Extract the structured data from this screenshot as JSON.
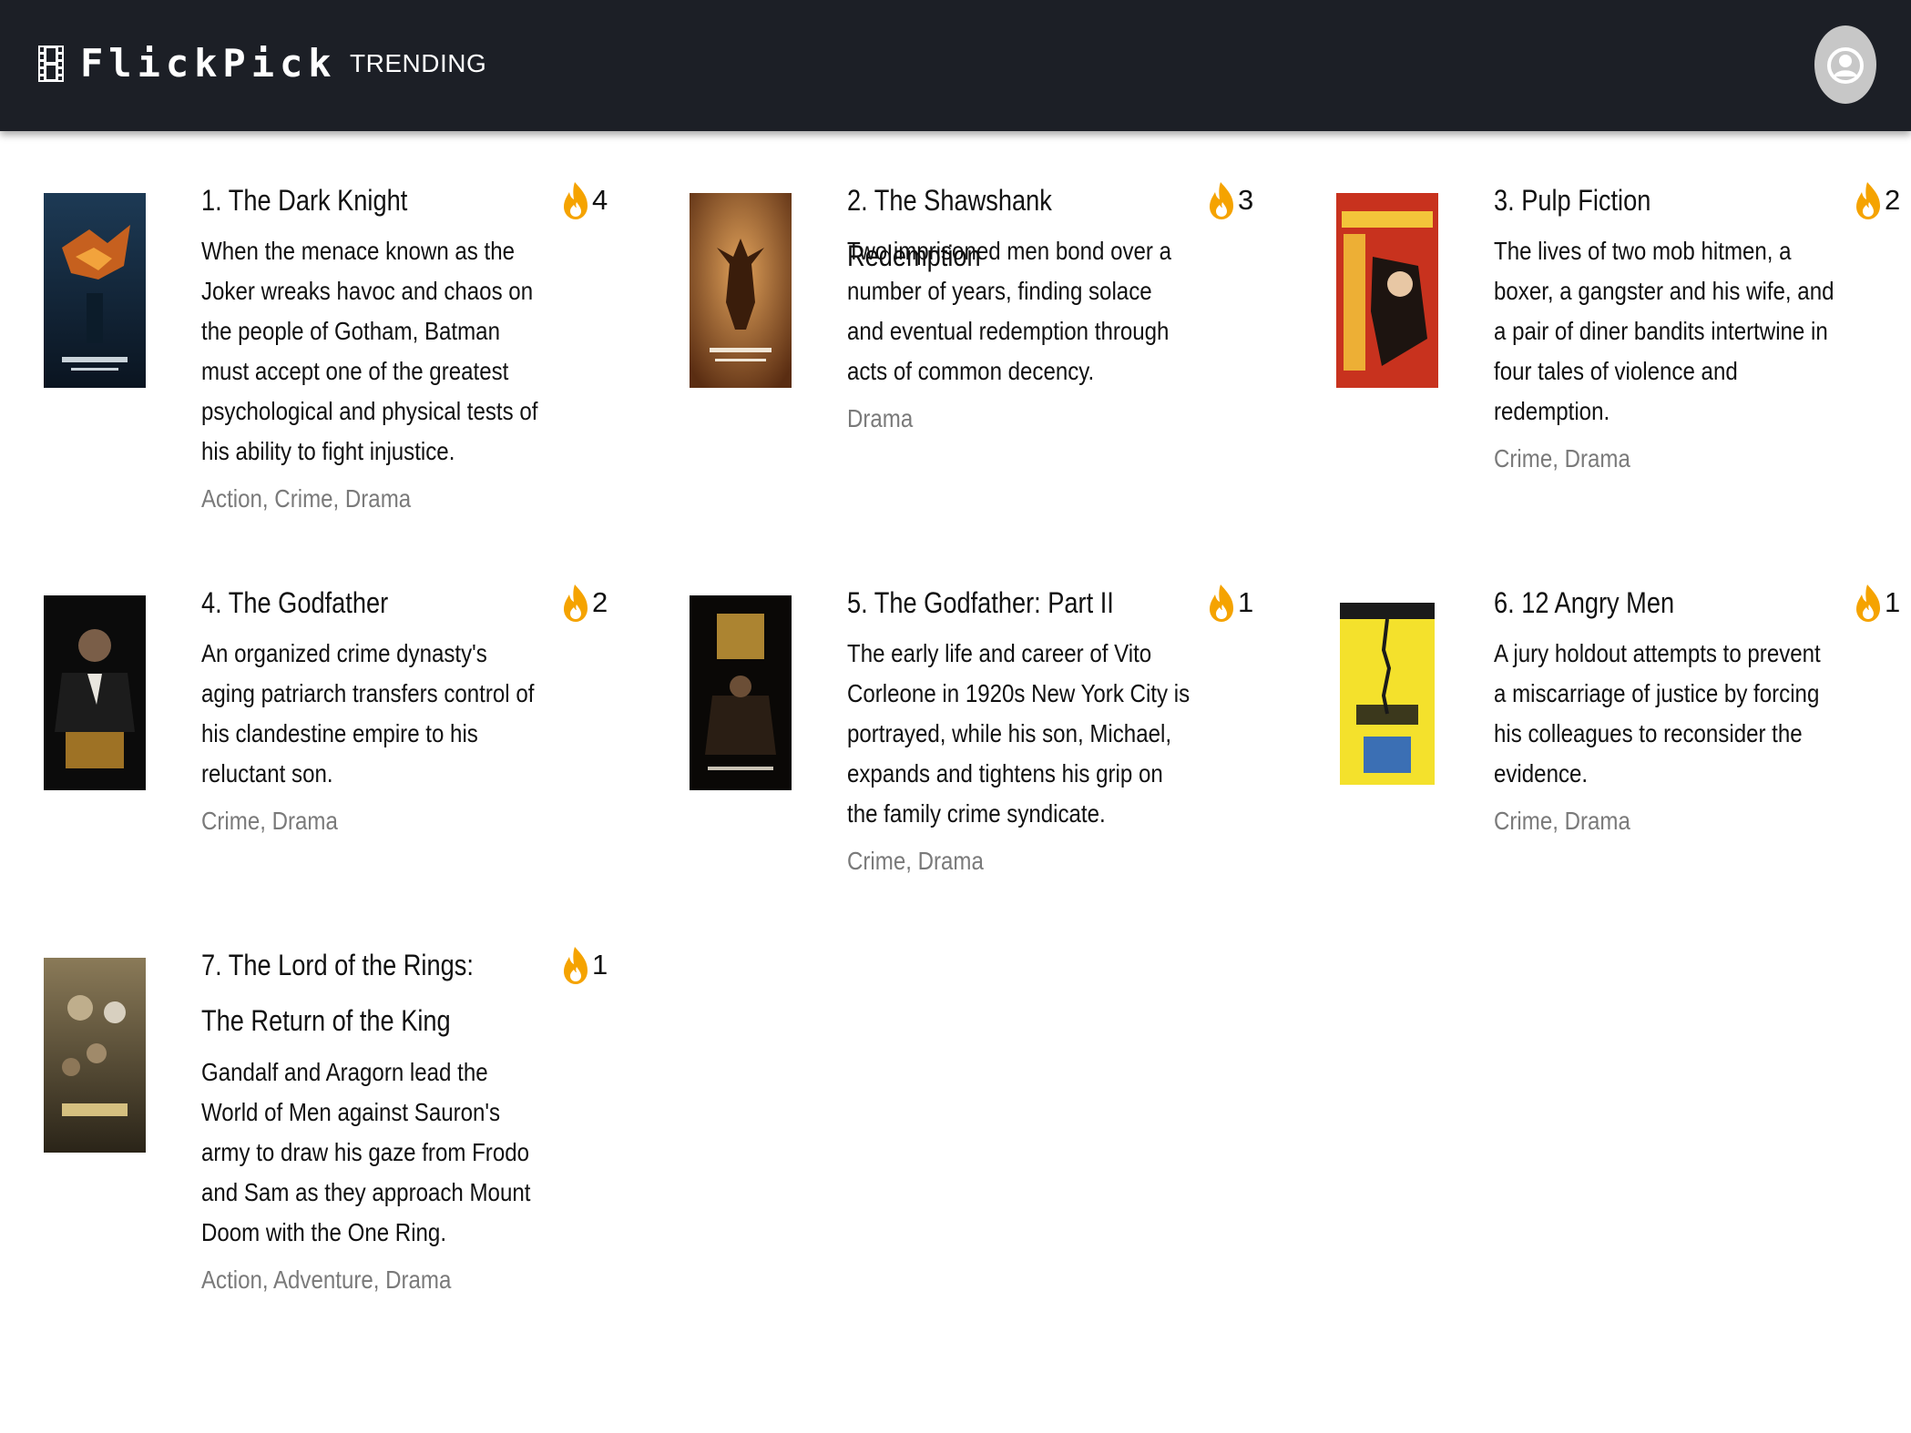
{
  "app": {
    "brand": "FlickPick",
    "nav_trending": "TRENDING"
  },
  "colors": {
    "topbar": "#1c1f26",
    "fire": "#f5a300",
    "genre_text": "#7a7a7a",
    "avatar_bg": "#c7c7c7"
  },
  "movies": [
    {
      "title": "1. The Dark Knight",
      "count": "4",
      "description": "When the menace known as the Joker wreaks havoc and chaos on the people of Gotham, Batman must accept one of the greatest psychological and physical tests of his ability to fight injustice.",
      "genres": "Action, Crime, Drama"
    },
    {
      "title": "2. The Shawshank Redemption",
      "count": "3",
      "description": "Two imprisoned men bond over a number of years, finding solace and eventual redemption through acts of common decency.",
      "genres": "Drama"
    },
    {
      "title": "3. Pulp Fiction",
      "count": "2",
      "description": "The lives of two mob hitmen, a boxer, a gangster and his wife, and a pair of diner bandits intertwine in four tales of violence and redemption.",
      "genres": "Crime, Drama"
    },
    {
      "title": "4. The Godfather",
      "count": "2",
      "description": "An organized crime dynasty's aging patriarch transfers control of his clandestine empire to his reluctant son.",
      "genres": "Crime, Drama"
    },
    {
      "title": "5. The Godfather: Part II",
      "count": "1",
      "description": "The early life and career of Vito Corleone in 1920s New York City is portrayed, while his son, Michael, expands and tightens his grip on the family crime syndicate.",
      "genres": "Crime, Drama"
    },
    {
      "title": "6. 12 Angry Men",
      "count": "1",
      "description": "A jury holdout attempts to prevent a miscarriage of justice by forcing his colleagues to reconsider the evidence.",
      "genres": "Crime, Drama"
    },
    {
      "title": "7. The Lord of the Rings: The Return of the King",
      "count": "1",
      "description": "Gandalf and Aragorn lead the World of Men against Sauron's army to draw his gaze from Frodo and Sam as they approach Mount Doom with the One Ring.",
      "genres": "Action, Adventure, Drama"
    }
  ]
}
